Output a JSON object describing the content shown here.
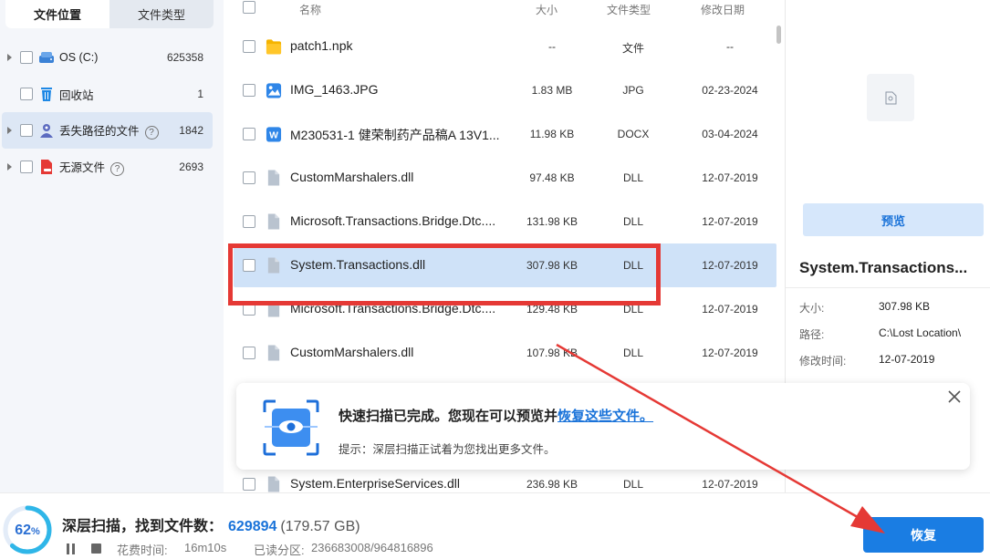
{
  "left_panel": {
    "tabs": [
      {
        "label": "文件位置",
        "active": true
      },
      {
        "label": "文件类型",
        "active": false
      }
    ],
    "tree": [
      {
        "label": "OS (C:)",
        "count": "625358",
        "icon": "drive-icon"
      },
      {
        "label": "回收站",
        "count": "1",
        "icon": "recycle-bin-icon"
      },
      {
        "label": "丢失路径的文件",
        "count": "1842",
        "icon": "lost-path-icon",
        "help": "?"
      },
      {
        "label": "无源文件",
        "count": "2693",
        "icon": "orphan-file-icon",
        "help": "?"
      }
    ]
  },
  "list": {
    "columns": {
      "name": "名称",
      "size": "大小",
      "type": "文件类型",
      "date": "修改日期"
    },
    "rows": [
      {
        "name": "patch1.npk",
        "size": "--",
        "type": "文件",
        "date": "--",
        "icon": "folder-icon"
      },
      {
        "name": "IMG_1463.JPG",
        "size": "1.83 MB",
        "type": "JPG",
        "date": "02-23-2024",
        "icon": "image-file-icon"
      },
      {
        "name": "M230531-1 健荣制药产品稿A 13V1...",
        "size": "11.98 KB",
        "type": "DOCX",
        "date": "03-04-2024",
        "icon": "word-doc-icon"
      },
      {
        "name": "CustomMarshalers.dll",
        "size": "97.48 KB",
        "type": "DLL",
        "date": "12-07-2019",
        "icon": "file-icon"
      },
      {
        "name": "Microsoft.Transactions.Bridge.Dtc....",
        "size": "131.98 KB",
        "type": "DLL",
        "date": "12-07-2019",
        "icon": "file-icon"
      },
      {
        "name": "System.Transactions.dll",
        "size": "307.98 KB",
        "type": "DLL",
        "date": "12-07-2019",
        "icon": "file-icon",
        "selected": true
      },
      {
        "name": "Microsoft.Transactions.Bridge.Dtc....",
        "size": "129.48 KB",
        "type": "DLL",
        "date": "12-07-2019",
        "icon": "file-icon"
      },
      {
        "name": "CustomMarshalers.dll",
        "size": "107.98 KB",
        "type": "DLL",
        "date": "12-07-2019",
        "icon": "file-icon"
      },
      {
        "name": "",
        "size": "",
        "type": "",
        "date": "",
        "icon": "file-icon"
      },
      {
        "name": "",
        "size": "",
        "type": "",
        "date": "",
        "icon": "file-icon"
      },
      {
        "name": "System.EnterpriseServices.dll",
        "size": "236.98 KB",
        "type": "DLL",
        "date": "12-07-2019",
        "icon": "file-icon"
      }
    ]
  },
  "detail": {
    "preview_label": "预览",
    "name": "System.Transactions...",
    "size_label": "大小:",
    "size": "307.98 KB",
    "path_label": "路径:",
    "path": "C:\\Lost Location\\",
    "modified_label": "修改时间:",
    "modified": "12-07-2019"
  },
  "toast": {
    "title": "快速扫描已完成。您现在可以预览并",
    "link": "恢复这些文件。",
    "hint": "提示：深层扫描正试着为您找出更多文件。"
  },
  "bottom": {
    "progress_percent": 62,
    "progress_value": "62",
    "progress_unit": "%",
    "scan_title": "深层扫描，找到文件数：",
    "found_count": "629894",
    "found_size": "(179.57 GB)",
    "elapsed_label": "花费时间:",
    "elapsed": "16m10s",
    "sectors_label": "已读分区:",
    "sectors": "236683008/964816896",
    "recover_label": "恢复"
  },
  "colors": {
    "accent": "#1a7de3",
    "selection": "#cfe2f8",
    "annotation": "#e53935"
  }
}
